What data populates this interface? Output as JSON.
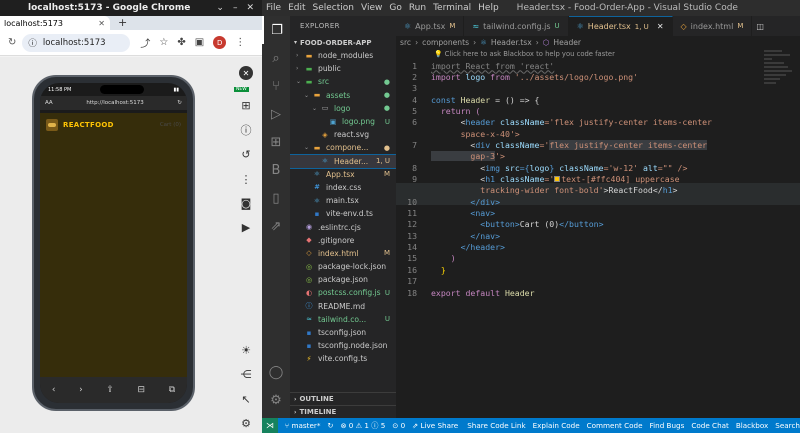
{
  "chrome": {
    "window_title": "localhost:5173 - Google Chrome",
    "tab_title": "localhost:5173",
    "new_tab": "+",
    "address": "localhost:5173",
    "profile_initial": "D",
    "phone": {
      "time": "11:58 PM",
      "url_left": "AA",
      "url": "http://localhost:5173",
      "brand": "REACTFOOD",
      "cart": "Cart (0)"
    },
    "new_badge": "NEW"
  },
  "vscode": {
    "menu": [
      "File",
      "Edit",
      "Selection",
      "View",
      "Go",
      "Run",
      "Terminal",
      "Help"
    ],
    "window_title": "Header.tsx - Food-Order-App - Visual Studio Code",
    "explorer": {
      "heading": "EXPLORER",
      "project": "FOOD-ORDER-APP",
      "outline": "OUTLINE",
      "timeline": "TIMELINE",
      "items": [
        {
          "name": "node_modules",
          "status": ""
        },
        {
          "name": "public",
          "status": ""
        },
        {
          "name": "src",
          "status": ""
        },
        {
          "name": "assets",
          "status": ""
        },
        {
          "name": "logo",
          "status": ""
        },
        {
          "name": "logo.png",
          "status": "U"
        },
        {
          "name": "react.svg",
          "status": ""
        },
        {
          "name": "compone...",
          "status": ""
        },
        {
          "name": "Header...",
          "status": "1, U"
        },
        {
          "name": "App.tsx",
          "status": "M"
        },
        {
          "name": "index.css",
          "status": ""
        },
        {
          "name": "main.tsx",
          "status": ""
        },
        {
          "name": "vite-env.d.ts",
          "status": ""
        },
        {
          "name": ".eslintrc.cjs",
          "status": ""
        },
        {
          "name": ".gitignore",
          "status": ""
        },
        {
          "name": "index.html",
          "status": "M"
        },
        {
          "name": "package-lock.json",
          "status": ""
        },
        {
          "name": "package.json",
          "status": ""
        },
        {
          "name": "postcss.config.js",
          "status": "U"
        },
        {
          "name": "README.md",
          "status": ""
        },
        {
          "name": "tailwind.co...",
          "status": "U"
        },
        {
          "name": "tsconfig.json",
          "status": ""
        },
        {
          "name": "tsconfig.node.json",
          "status": ""
        },
        {
          "name": "vite.config.ts",
          "status": ""
        }
      ]
    },
    "tabs": [
      {
        "label": "App.tsx",
        "status": "M"
      },
      {
        "label": "tailwind.config.js",
        "status": "U"
      },
      {
        "label": "Header.tsx",
        "status": "1, U"
      },
      {
        "label": "index.html",
        "status": "M"
      }
    ],
    "breadcrumbs": [
      "src",
      "components",
      "Header.tsx",
      "Header"
    ],
    "hint": "Click here to ask Blackbox to help you code faster",
    "line_numbers": [
      "1",
      "2",
      "3",
      "4",
      "5",
      "6",
      "",
      "7",
      "",
      "8",
      "9",
      "",
      "10",
      "11",
      "12",
      "13",
      "14",
      "15",
      "16",
      "17",
      "18"
    ],
    "code": {
      "l1": "import React from 'react'",
      "l2a": "import",
      "l2b": " logo ",
      "l2c": "from",
      "l2d": " '../assets/logo/logo.png'",
      "l4a": "const",
      "l4b": " Header",
      "l4c": " = () => {",
      "l5": "  return (",
      "l6a": "      <",
      "l6b": "header",
      "l6c": " className",
      "l6d": "='flex justify-center items-center",
      "l6e": "      space-x-40'>",
      "l7a": "        <",
      "l7b": "div",
      "l7c": " className",
      "l7d": "='",
      "l7e": "flex justify-center items-center",
      "l7f": "        gap-3",
      "l7g": "'>",
      "l8a": "          <",
      "l8b": "img",
      "l8c": " src",
      "l8d": "={",
      "l8e": "logo",
      "l8f": "} ",
      "l8g": "className",
      "l8h": "='w-12' ",
      "l8i": "alt",
      "l8j": "=\"\" />",
      "l9a": "          <",
      "l9b": "h1",
      "l9c": " className",
      "l9d": "='",
      "l9e": "text-[#ffc404] uppercase",
      "l9f": "          tracking-wider font-bold'",
      "l9g": ">ReactFood</",
      "l9h": "h1",
      "l9i": ">",
      "l10": "        </div>",
      "l11": "        <nav>",
      "l12a": "          <button>",
      "l12b": "Cart (0)",
      "l12c": "</button>",
      "l13": "        </nav>",
      "l14": "      </header>",
      "l15": "    )",
      "l16": "  }",
      "l18a": "export default",
      "l18b": " Header"
    },
    "status": {
      "branch": "master*",
      "sync": "↻",
      "problems": "⊗ 0 ⚠ 1 ⓘ 5",
      "port": "⊙ 0",
      "live_share": "Live Share",
      "items": [
        "Share Code Link",
        "Explain Code",
        "Comment Code",
        "Find Bugs",
        "Code Chat",
        "Blackbox",
        "Search"
      ]
    }
  }
}
